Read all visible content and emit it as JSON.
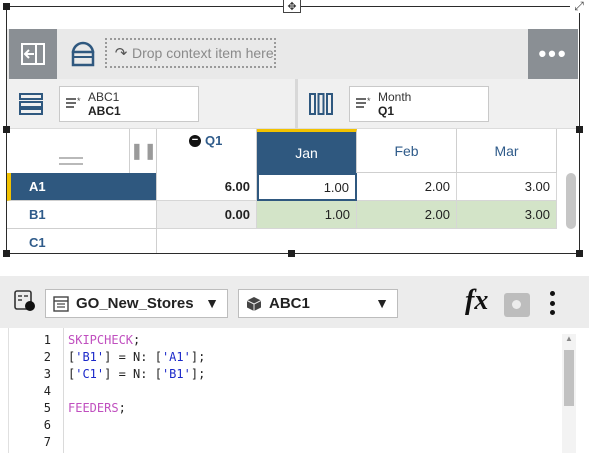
{
  "toolbar": {
    "drop_placeholder": "Drop context item here"
  },
  "rows_dimension": {
    "line1": "ABC1",
    "line2": "ABC1"
  },
  "columns_dimension": {
    "line1": "Month",
    "line2": "Q1"
  },
  "grid": {
    "consolidated_header": "Q1",
    "columns": [
      "Jan",
      "Feb",
      "Mar"
    ],
    "selected_column": "Jan",
    "rows": [
      {
        "label": "A1",
        "total": "6.00",
        "values": [
          "1.00",
          "2.00",
          "3.00"
        ],
        "selected": true
      },
      {
        "label": "B1",
        "total": "0.00",
        "values": [
          "1.00",
          "2.00",
          "3.00"
        ],
        "selected": false
      },
      {
        "label": "C1",
        "total": "",
        "values": [
          "",
          "",
          ""
        ],
        "selected": false
      }
    ]
  },
  "editor": {
    "cube_select": "GO_New_Stores",
    "dimension_select": "ABC1",
    "fx_label": "fx",
    "line_numbers": [
      "1",
      "2",
      "3",
      "4",
      "5",
      "6",
      "7"
    ],
    "lines": [
      {
        "kw": "SKIPCHECK",
        "rest": ";"
      },
      {
        "text": "['B1'] = N: ['A1'];"
      },
      {
        "text": "['C1'] = N: ['B1'];"
      },
      {
        "text": ""
      },
      {
        "kw": "FEEDERS",
        "rest": ";"
      },
      {
        "text": ""
      },
      {
        "text": ""
      }
    ]
  },
  "colors": {
    "accent_dark": "#2f587f",
    "highlight_yellow": "#f2c200",
    "input_green": "#d3e4c8",
    "keyword_magenta": "#c04fbf",
    "string_blue": "#1b28c9"
  },
  "icons": [
    "move-icon",
    "resize-icon",
    "exit-icon",
    "layout-icon",
    "undo-arrow-icon",
    "more-icon",
    "rows-icon",
    "columns-icon",
    "dimension-subset-icon",
    "collapse-icon",
    "calculator-icon",
    "cube-icon",
    "dimension-cube-icon",
    "save-disk-icon",
    "kebab-icon"
  ]
}
